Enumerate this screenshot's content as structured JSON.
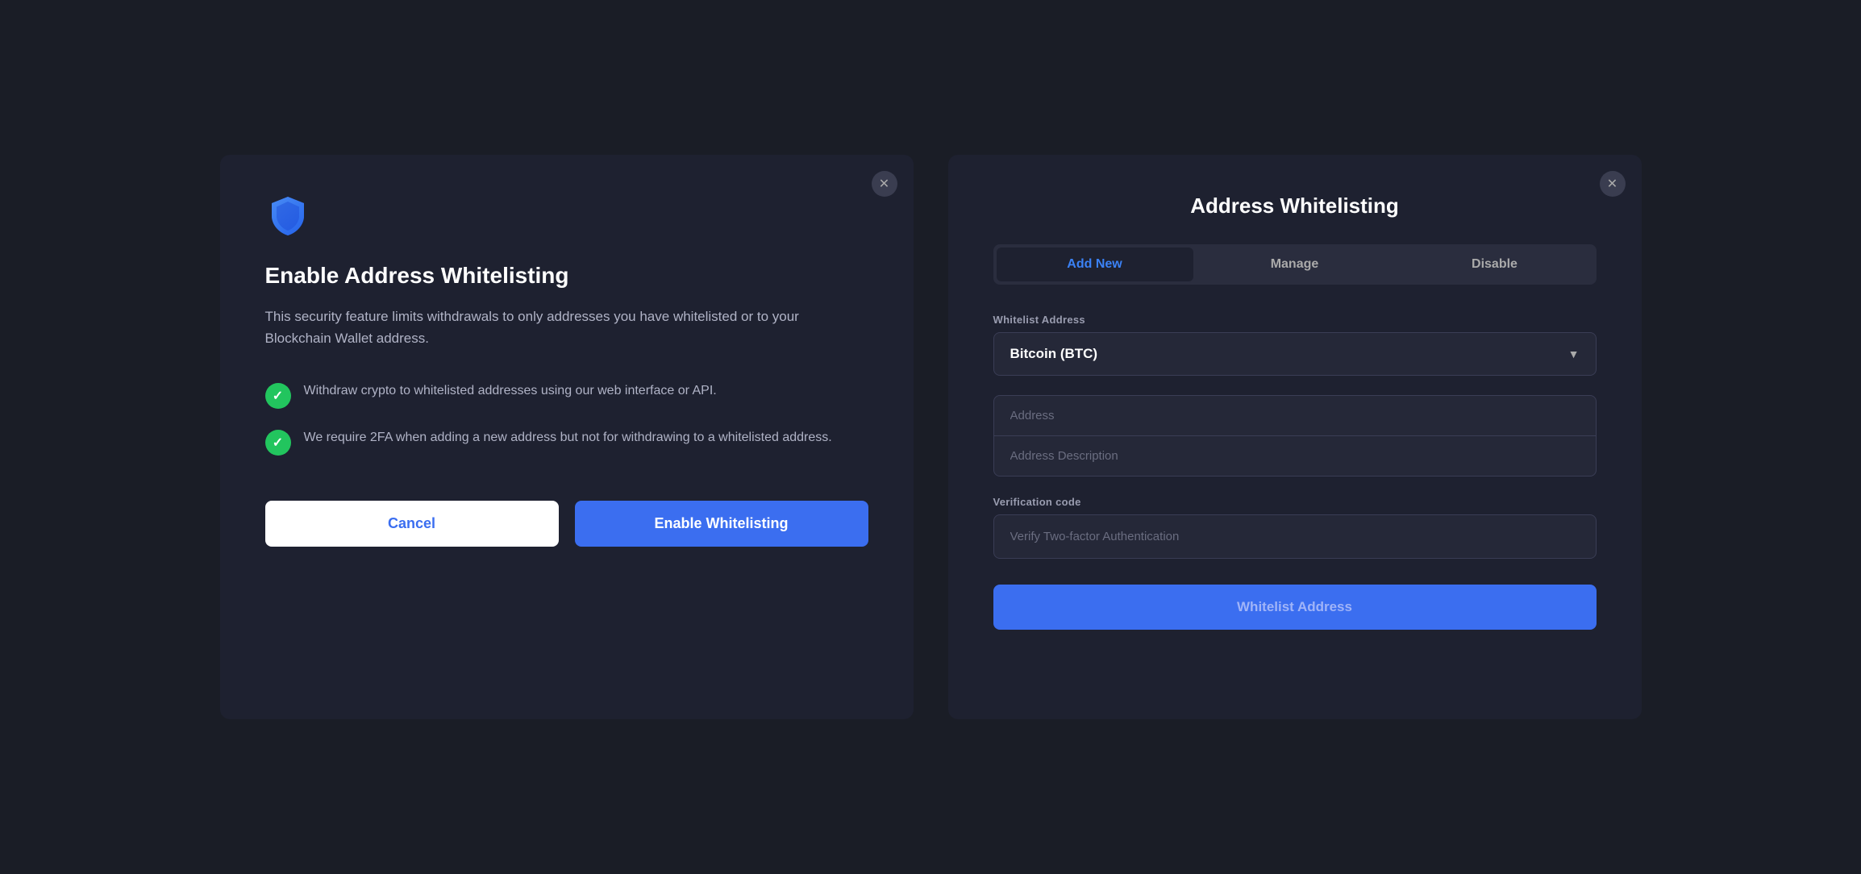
{
  "left_modal": {
    "title": "Enable Address Whitelisting",
    "description": "This security feature limits withdrawals to only addresses you have whitelisted or to your Blockchain Wallet address.",
    "features": [
      {
        "text": "Withdraw crypto to whitelisted addresses using our web interface or API."
      },
      {
        "text": "We require 2FA when adding a new address but not for withdrawing to a whitelisted address."
      }
    ],
    "cancel_label": "Cancel",
    "enable_label": "Enable Whitelisting",
    "close_icon": "✕"
  },
  "right_modal": {
    "title": "Address Whitelisting",
    "tabs": [
      {
        "label": "Add New",
        "active": true
      },
      {
        "label": "Manage",
        "active": false
      },
      {
        "label": "Disable",
        "active": false
      }
    ],
    "whitelist_address_label": "Whitelist Address",
    "currency_selected": "Bitcoin (BTC)",
    "address_placeholder": "Address",
    "address_description_placeholder": "Address Description",
    "verification_code_label": "Verification code",
    "verification_placeholder": "Verify Two-factor Authentication",
    "submit_label": "Whitelist Address",
    "close_icon": "✕"
  }
}
